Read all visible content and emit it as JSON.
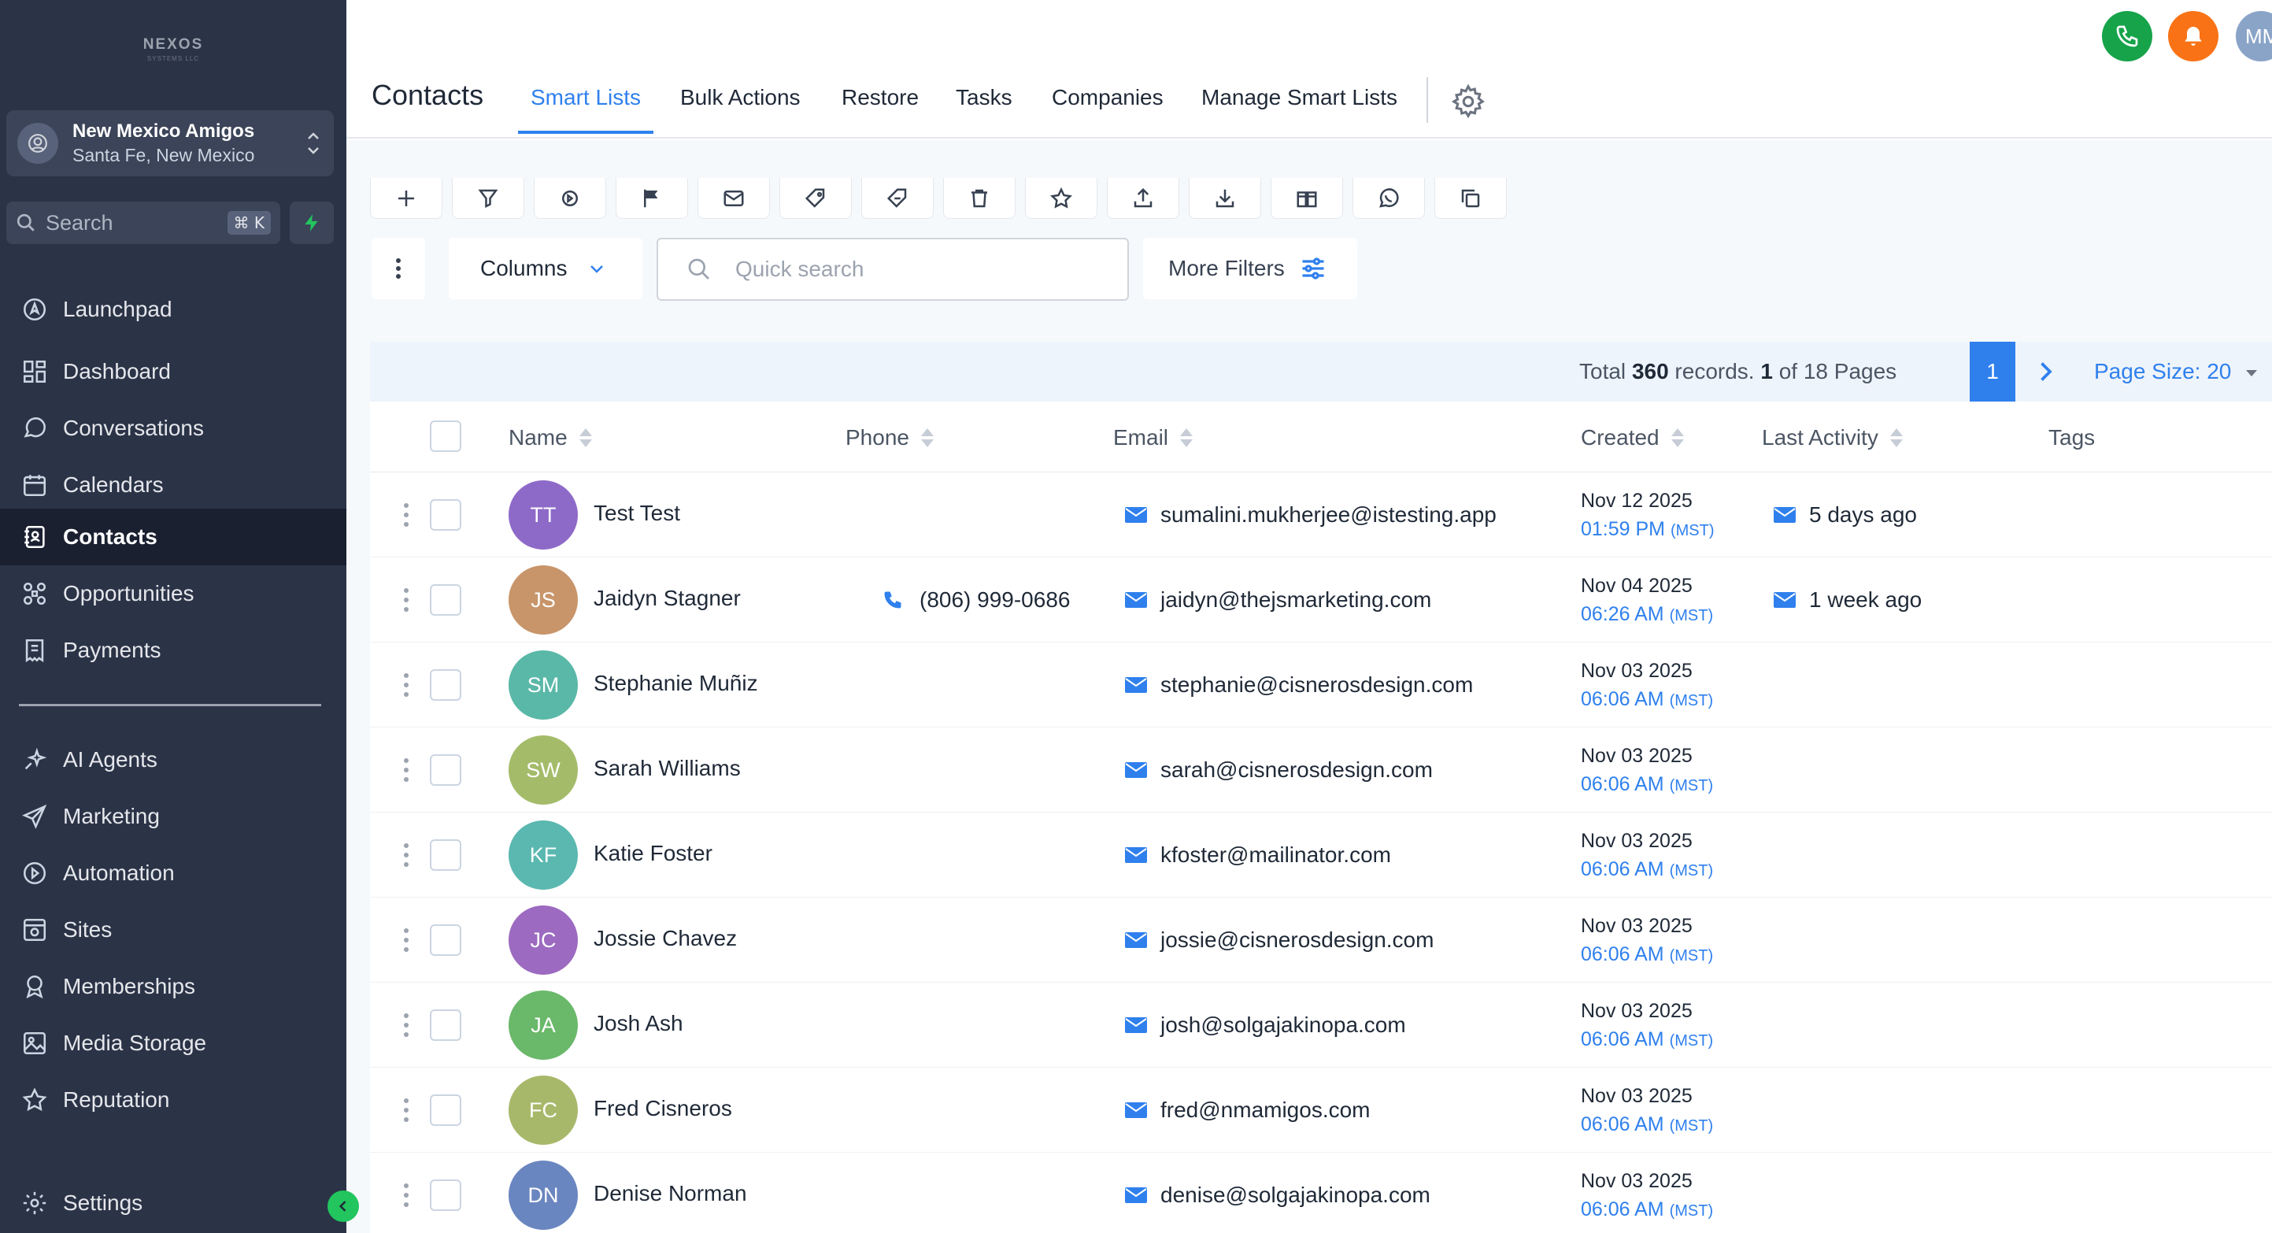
{
  "brand": {
    "logo_text": "NEXOS",
    "logo_sub": "SYSTEMS LLC"
  },
  "location": {
    "name": "New Mexico Amigos",
    "sub": "Santa Fe, New Mexico"
  },
  "sidebar_search": {
    "label": "Search",
    "shortcut": "⌘ K"
  },
  "nav": [
    {
      "label": "Launchpad",
      "icon": "launchpad-icon"
    },
    {
      "label": "Dashboard",
      "icon": "dashboard-icon"
    },
    {
      "label": "Conversations",
      "icon": "chat-icon"
    },
    {
      "label": "Calendars",
      "icon": "calendar-icon"
    },
    {
      "label": "Contacts",
      "icon": "contacts-icon",
      "active": true
    },
    {
      "label": "Opportunities",
      "icon": "opportunities-icon"
    },
    {
      "label": "Payments",
      "icon": "payments-icon"
    },
    {
      "label": "AI Agents",
      "icon": "sparkle-icon"
    },
    {
      "label": "Marketing",
      "icon": "send-icon"
    },
    {
      "label": "Automation",
      "icon": "automation-icon"
    },
    {
      "label": "Sites",
      "icon": "sites-icon"
    },
    {
      "label": "Memberships",
      "icon": "badge-icon"
    },
    {
      "label": "Media Storage",
      "icon": "image-icon"
    },
    {
      "label": "Reputation",
      "icon": "star-icon"
    }
  ],
  "settings_label": "Settings",
  "header": {
    "title": "Contacts",
    "tabs": [
      "Smart Lists",
      "Bulk Actions",
      "Restore",
      "Tasks",
      "Companies",
      "Manage Smart Lists"
    ],
    "active_tab": "Smart Lists",
    "user_initials": "MM"
  },
  "toolbar": {
    "action_icons": [
      "plus-icon",
      "filter-icon",
      "workflow-icon",
      "flag-icon",
      "mail-icon",
      "tag-add-icon",
      "tag-remove-icon",
      "trash-icon",
      "star-icon",
      "export-icon",
      "import-icon",
      "merge-icon",
      "whatsapp-icon",
      "copy-icon"
    ],
    "columns_label": "Columns",
    "search_placeholder": "Quick search",
    "more_filters_label": "More Filters"
  },
  "pager": {
    "total_prefix": "Total ",
    "total": "360",
    "total_suffix": " records. ",
    "page": "1",
    "of_text": " of 18 Pages",
    "current_page": "1",
    "page_size_label": "Page Size: 20"
  },
  "table": {
    "columns": [
      "Name",
      "Phone",
      "Email",
      "Created",
      "Last Activity",
      "Tags"
    ],
    "rows": [
      {
        "initials": "TT",
        "color": "#8e6ac8",
        "name": "Test Test",
        "phone": "",
        "email": "sumalini.mukherjee@istesting.app",
        "date": "Nov 12 2025",
        "time": "01:59 PM",
        "tz": "(MST)",
        "activity": "5 days ago"
      },
      {
        "initials": "JS",
        "color": "#c8956a",
        "name": "Jaidyn Stagner",
        "phone": "(806) 999-0686",
        "email": "jaidyn@thejsmarketing.com",
        "date": "Nov 04 2025",
        "time": "06:26 AM",
        "tz": "(MST)",
        "activity": "1 week ago"
      },
      {
        "initials": "SM",
        "color": "#5ab8a8",
        "name": "Stephanie Muñiz",
        "phone": "",
        "email": "stephanie@cisnerosdesign.com",
        "date": "Nov 03 2025",
        "time": "06:06 AM",
        "tz": "(MST)",
        "activity": ""
      },
      {
        "initials": "SW",
        "color": "#a4bc6a",
        "name": "Sarah Williams",
        "phone": "",
        "email": "sarah@cisnerosdesign.com",
        "date": "Nov 03 2025",
        "time": "06:06 AM",
        "tz": "(MST)",
        "activity": ""
      },
      {
        "initials": "KF",
        "color": "#5ab8b0",
        "name": "Katie Foster",
        "phone": "",
        "email": "kfoster@mailinator.com",
        "date": "Nov 03 2025",
        "time": "06:06 AM",
        "tz": "(MST)",
        "activity": ""
      },
      {
        "initials": "JC",
        "color": "#9c6ac0",
        "name": "Jossie Chavez",
        "phone": "",
        "email": "jossie@cisnerosdesign.com",
        "date": "Nov 03 2025",
        "time": "06:06 AM",
        "tz": "(MST)",
        "activity": ""
      },
      {
        "initials": "JA",
        "color": "#6ab86a",
        "name": "Josh Ash",
        "phone": "",
        "email": "josh@solgajakinopa.com",
        "date": "Nov 03 2025",
        "time": "06:06 AM",
        "tz": "(MST)",
        "activity": ""
      },
      {
        "initials": "FC",
        "color": "#a8b86a",
        "name": "Fred Cisneros",
        "phone": "",
        "email": "fred@nmamigos.com",
        "date": "Nov 03 2025",
        "time": "06:06 AM",
        "tz": "(MST)",
        "activity": ""
      },
      {
        "initials": "DN",
        "color": "#6a86c0",
        "name": "Denise Norman",
        "phone": "",
        "email": "denise@solgajakinopa.com",
        "date": "Nov 03 2025",
        "time": "06:06 AM",
        "tz": "(MST)",
        "activity": ""
      }
    ]
  },
  "colors": {
    "accent": "#2f80ed",
    "sidebar": "#2b3347",
    "phone_btn": "#16a34a",
    "bell_btn": "#f97316"
  }
}
